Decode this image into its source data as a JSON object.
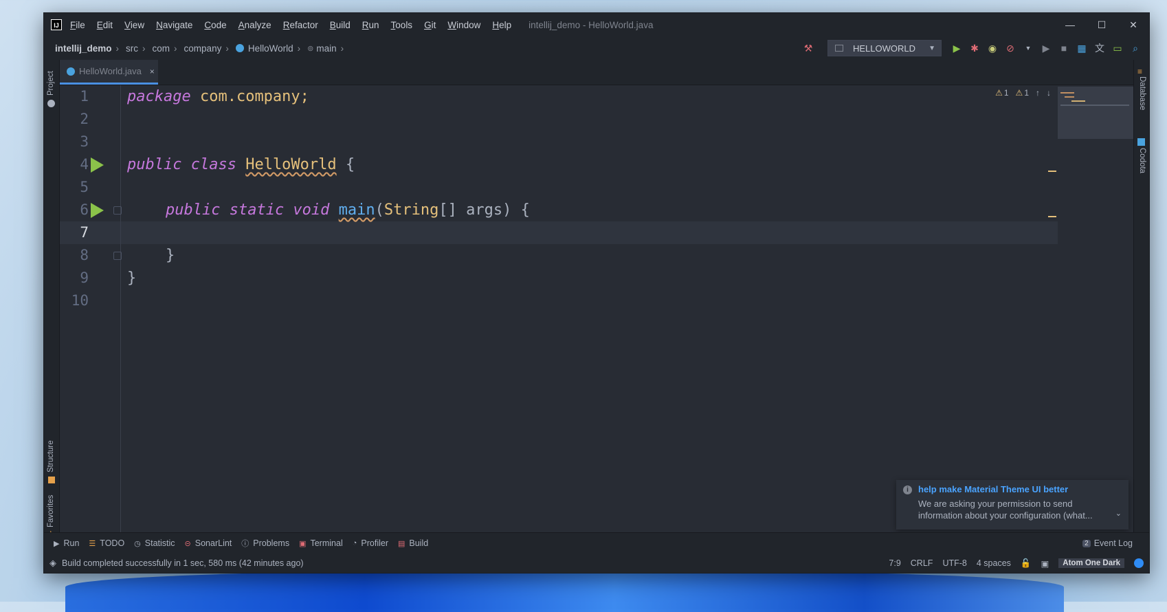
{
  "window": {
    "title": "intellij_demo - HelloWorld.java",
    "app_icon": "IJ",
    "minimize": "—",
    "maximize": "☐",
    "close": "✕"
  },
  "menu": [
    "File",
    "Edit",
    "View",
    "Navigate",
    "Code",
    "Analyze",
    "Refactor",
    "Build",
    "Run",
    "Tools",
    "Git",
    "Window",
    "Help"
  ],
  "breadcrumb": {
    "project": "intellij_demo",
    "items": [
      "src",
      "com",
      "company",
      "HelloWorld",
      "main"
    ]
  },
  "run_config": {
    "label": "HELLOWORLD"
  },
  "left_strip": {
    "project": "Project",
    "structure": "Structure",
    "favorites": "Favorites"
  },
  "right_strip": {
    "database": "Database",
    "codota": "Codota"
  },
  "tab": {
    "name": "HelloWorld.java",
    "close": "×"
  },
  "line_numbers": [
    "1",
    "2",
    "3",
    "4",
    "5",
    "6",
    "7",
    "8",
    "9",
    "10"
  ],
  "code": {
    "l1_kw": "package",
    "l1_pkg": "com.company",
    "l1_end": ";",
    "l4_kw": "public class",
    "l4_cls": "HelloWorld",
    "l4_end": "{",
    "l6_kw": "public static void",
    "l6_fn": "main",
    "l6_open": "(",
    "l6_type": "String",
    "l6_rest": "[] args) {",
    "l8": "}",
    "l9": "}"
  },
  "inspections": {
    "warnings": "1",
    "weak_warnings": "1"
  },
  "notification": {
    "title": "help make Material Theme UI better",
    "body": "We are asking your permission to send information about your configuration (what..."
  },
  "tool_windows": [
    {
      "icon": "▶",
      "label": "Run"
    },
    {
      "icon": "☰",
      "label": "TODO"
    },
    {
      "icon": "◷",
      "label": "Statistic"
    },
    {
      "icon": "⊝",
      "label": "SonarLint"
    },
    {
      "icon": "ⓘ",
      "label": "Problems"
    },
    {
      "icon": "▣",
      "label": "Terminal"
    },
    {
      "icon": "◔",
      "label": "Profiler"
    },
    {
      "icon": "▤",
      "label": "Build"
    }
  ],
  "event_log": {
    "count": "2",
    "label": "Event Log"
  },
  "status": {
    "message": "Build completed successfully in 1 sec, 580 ms (42 minutes ago)",
    "position": "7:9",
    "line_sep": "CRLF",
    "encoding": "UTF-8",
    "indent": "4 spaces",
    "theme": "Atom One Dark"
  },
  "colors": {
    "accent": "#4a90e2",
    "run_green": "#8bc34a",
    "keyword": "#c678dd",
    "type": "#e5c07b",
    "function": "#61afef"
  }
}
